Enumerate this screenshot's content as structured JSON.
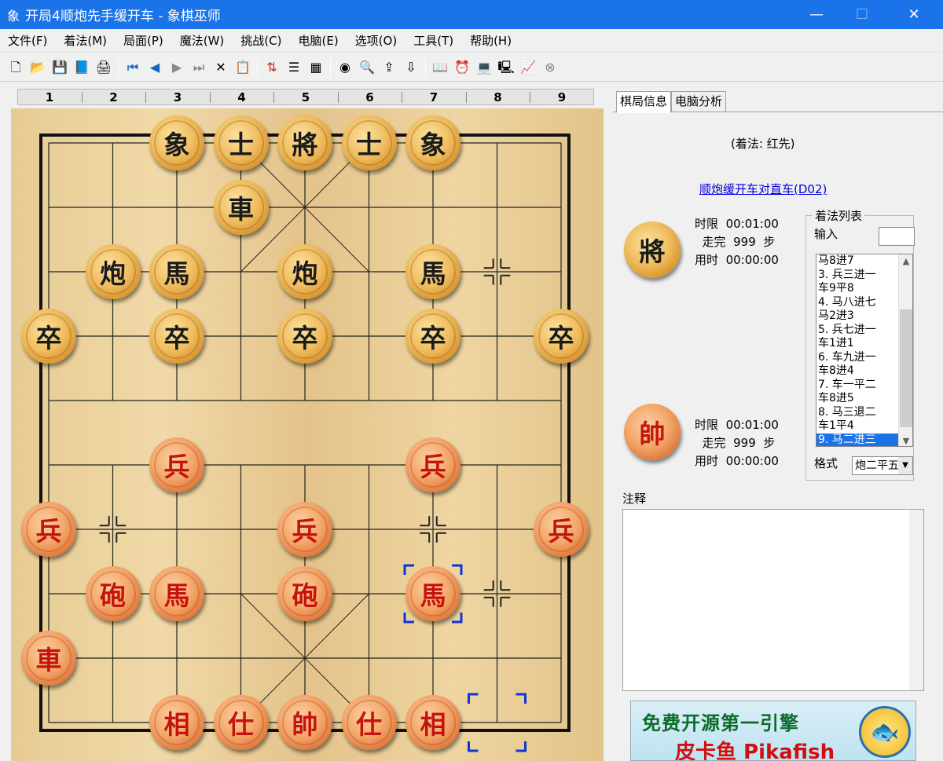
{
  "window": {
    "app_icon_glyph": "象",
    "title": "开局4顺炮先手缓开车 - 象棋巫师",
    "minimize": "—",
    "maximize": "☐",
    "close": "✕"
  },
  "menu": [
    "文件(F)",
    "着法(M)",
    "局面(P)",
    "魔法(W)",
    "挑战(C)",
    "电脑(E)",
    "选项(O)",
    "工具(T)",
    "帮助(H)"
  ],
  "toolbar": {
    "groups": [
      [
        "new-file-icon",
        "open-folder-icon",
        "save-icon",
        "save-as-icon",
        "print-setup-icon"
      ],
      [
        "first-move-icon",
        "prev-move-icon",
        "next-move-icon",
        "last-move-icon",
        "delete-icon",
        "paste-icon"
      ],
      [
        "flip-board-icon",
        "move-tree-icon",
        "edit-position-icon"
      ],
      [
        "colorwheel-icon",
        "analyze-icon",
        "export-icon",
        "import-icon"
      ],
      [
        "book-icon",
        "clock-icon",
        "computer-icon",
        "computer2-icon",
        "monitor-icon",
        "stop-icon"
      ]
    ]
  },
  "board": {
    "column_numbers": [
      "1",
      "2",
      "3",
      "4",
      "5",
      "6",
      "7",
      "8",
      "9"
    ],
    "pieces": [
      {
        "file": 1,
        "rank": 0,
        "char": "象",
        "side": "black"
      },
      {
        "file": 2,
        "rank": 0,
        "char": "士",
        "side": "black"
      },
      {
        "file": 3,
        "rank": 0,
        "char": "將",
        "side": "black"
      },
      {
        "file": 4,
        "rank": 0,
        "char": "士",
        "side": "black"
      },
      {
        "file": 5,
        "rank": 0,
        "char": "象",
        "side": "black"
      },
      {
        "file": 2,
        "rank": 1,
        "char": "車",
        "side": "black"
      },
      {
        "file": 0,
        "rank": 2,
        "char": "炮",
        "side": "black"
      },
      {
        "file": 1,
        "rank": 2,
        "char": "馬",
        "side": "black"
      },
      {
        "file": 3,
        "rank": 2,
        "char": "炮",
        "side": "black"
      },
      {
        "file": 5,
        "rank": 2,
        "char": "馬",
        "side": "black"
      },
      {
        "file": -1,
        "rank": 3,
        "char": "卒",
        "side": "black"
      },
      {
        "file": 1,
        "rank": 3,
        "char": "卒",
        "side": "black"
      },
      {
        "file": 3,
        "rank": 3,
        "char": "卒",
        "side": "black"
      },
      {
        "file": 5,
        "rank": 3,
        "char": "卒",
        "side": "black"
      },
      {
        "file": 7,
        "rank": 3,
        "char": "卒",
        "side": "black"
      },
      {
        "file": 1,
        "rank": 5,
        "char": "兵",
        "side": "red"
      },
      {
        "file": 5,
        "rank": 5,
        "char": "兵",
        "side": "red"
      },
      {
        "file": -1,
        "rank": 6,
        "char": "兵",
        "side": "red"
      },
      {
        "file": 3,
        "rank": 6,
        "char": "兵",
        "side": "red"
      },
      {
        "file": 7,
        "rank": 6,
        "char": "兵",
        "side": "red"
      },
      {
        "file": 0,
        "rank": 7,
        "char": "砲",
        "side": "red"
      },
      {
        "file": 1,
        "rank": 7,
        "char": "馬",
        "side": "red"
      },
      {
        "file": 3,
        "rank": 7,
        "char": "砲",
        "side": "red"
      },
      {
        "file": 5,
        "rank": 7,
        "char": "馬",
        "side": "red"
      },
      {
        "file": -1,
        "rank": 8,
        "char": "車",
        "side": "red"
      },
      {
        "file": 1,
        "rank": 9,
        "char": "相",
        "side": "red"
      },
      {
        "file": 2,
        "rank": 9,
        "char": "仕",
        "side": "red"
      },
      {
        "file": 3,
        "rank": 9,
        "char": "帥",
        "side": "red"
      },
      {
        "file": 4,
        "rank": 9,
        "char": "仕",
        "side": "red"
      },
      {
        "file": 5,
        "rank": 9,
        "char": "相",
        "side": "red"
      }
    ]
  },
  "panel": {
    "tabs": [
      "棋局信息",
      "电脑分析"
    ],
    "move_header": "(着法: 红先)",
    "opening_link": "顺炮缓开车对直车(D02)",
    "black": {
      "piece": "將",
      "time_limit_label": "时限",
      "time_limit": "00:01:00",
      "moves_label": "走完",
      "moves": "999",
      "moves_unit": "步",
      "used_label": "用时",
      "used": "00:00:00"
    },
    "red": {
      "piece": "帥",
      "time_limit_label": "时限",
      "time_limit": "00:01:00",
      "moves_label": "走完",
      "moves": "999",
      "moves_unit": "步",
      "used_label": "用时",
      "used": "00:00:00"
    },
    "move_list_title": "着法列表",
    "input_label": "输入",
    "moves": [
      "   马8进7",
      "3. 兵三进一",
      "   车9平8",
      "4. 马八进七",
      "   马2进3",
      "5. 兵七进一",
      "   车1进1",
      "6. 车九进一",
      "   车8进4",
      "7. 车一平二",
      "   车8进5",
      "8. 马三退二",
      "   车1平4",
      "9. 马二进三"
    ],
    "selected_move_index": 13,
    "format_label": "格式",
    "format_value": "炮二平五",
    "notes_label": "注释",
    "ad_line1": "免费开源第一引擎",
    "ad_line2": "皮卡鱼 Pikafish"
  }
}
